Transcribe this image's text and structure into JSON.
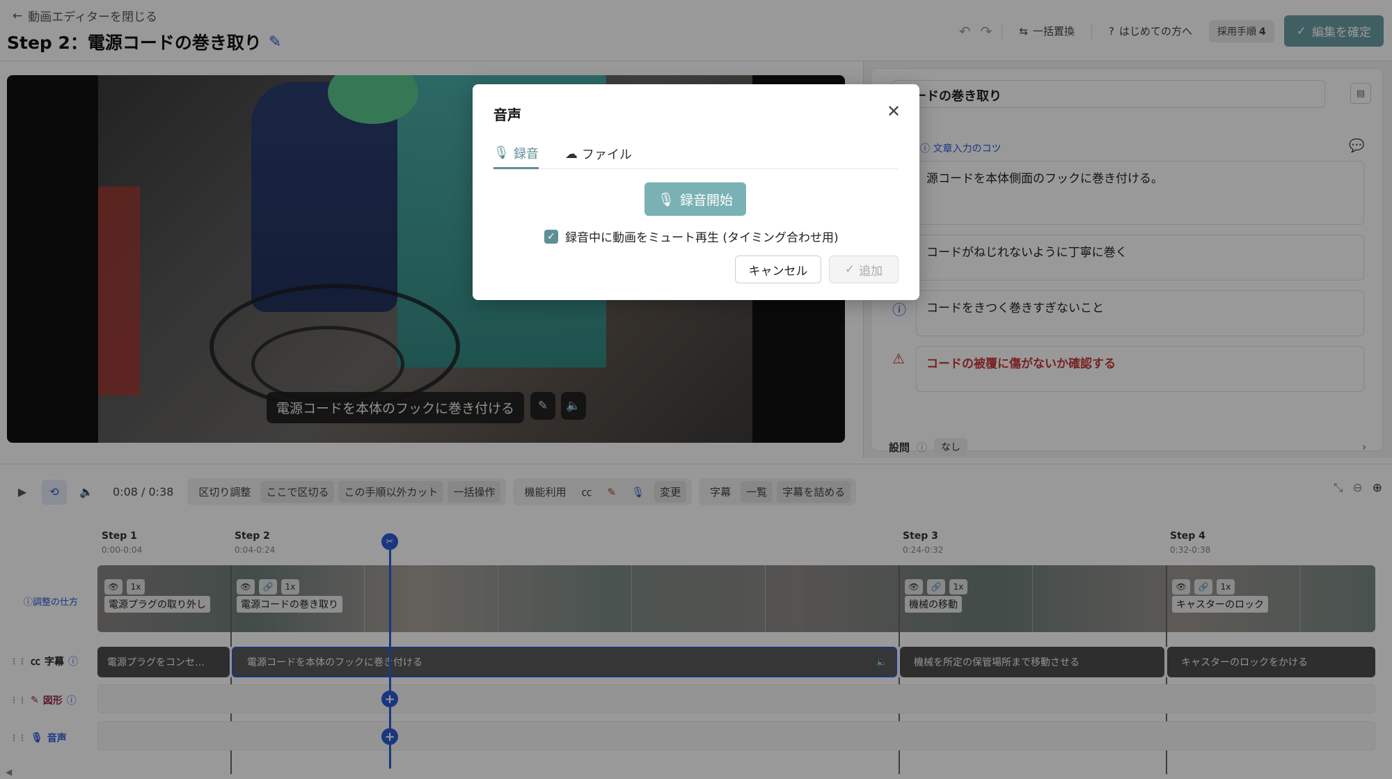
{
  "header": {
    "back_label": "動画エディターを閉じる",
    "title": "Step 2：電源コードの巻き取り",
    "replace_all": "一括置換",
    "first_time": "はじめての方へ",
    "adopted_steps_label": "採用手順",
    "adopted_steps_count": "4",
    "confirm_label": "編集を確定"
  },
  "video": {
    "caption": "電源コードを本体のフックに巻き付ける"
  },
  "right_panel": {
    "title_value": "コードの巻き取り",
    "tips_link": "文章入力のコツ",
    "main_text": "源コードを本体側面のフックに巻き付ける。",
    "point_text": "コードがねじれないように丁寧に巻く",
    "info_text": "コードをきつく巻きすぎないこと",
    "warn_text": "コードの被覆に傷がないか確認する",
    "question_label": "設問",
    "question_value": "なし"
  },
  "toolbar": {
    "time": "0:08 / 0:38",
    "split_adjust": "区切り調整",
    "split_here": "ここで区切る",
    "cut_others": "この手順以外カット",
    "bulk_ops": "一括操作",
    "feature_use": "機能利用",
    "change": "変更",
    "subtitles": "字幕",
    "list": "一覧",
    "compact_subtitles": "字幕を詰める"
  },
  "timeline": {
    "adjust_help": "調整の仕方",
    "steps": [
      {
        "label": "Step 1",
        "range": "0:00-0:04",
        "name": "電源プラグの取り外し"
      },
      {
        "label": "Step 2",
        "range": "0:04-0:24",
        "name": "電源コードの巻き取り"
      },
      {
        "label": "Step 3",
        "range": "0:24-0:32",
        "name": "機械の移動"
      },
      {
        "label": "Step 4",
        "range": "0:32-0:38",
        "name": "キャスターのロック"
      }
    ],
    "speed": "1x",
    "tracks": {
      "subtitle": "字幕",
      "shape": "図形",
      "audio": "音声"
    },
    "subtitles": [
      "電源プラグをコンセ…",
      "電源コードを本体のフックに巻き付ける",
      "機械を所定の保管場所まで移動させる",
      "キャスターのロックをかける"
    ]
  },
  "modal": {
    "title": "音声",
    "tab_record": "録音",
    "tab_file": "ファイル",
    "record_button": "録音開始",
    "mute_checkbox_label": "録音中に動画をミュート再生 (タイミング合わせ用)",
    "mute_checked": true,
    "cancel": "キャンセル",
    "add": "追加"
  },
  "colors": {
    "accent_teal": "#5d8f94",
    "accent_blue": "#2c5bd8",
    "warning_red": "#c83a3a"
  }
}
